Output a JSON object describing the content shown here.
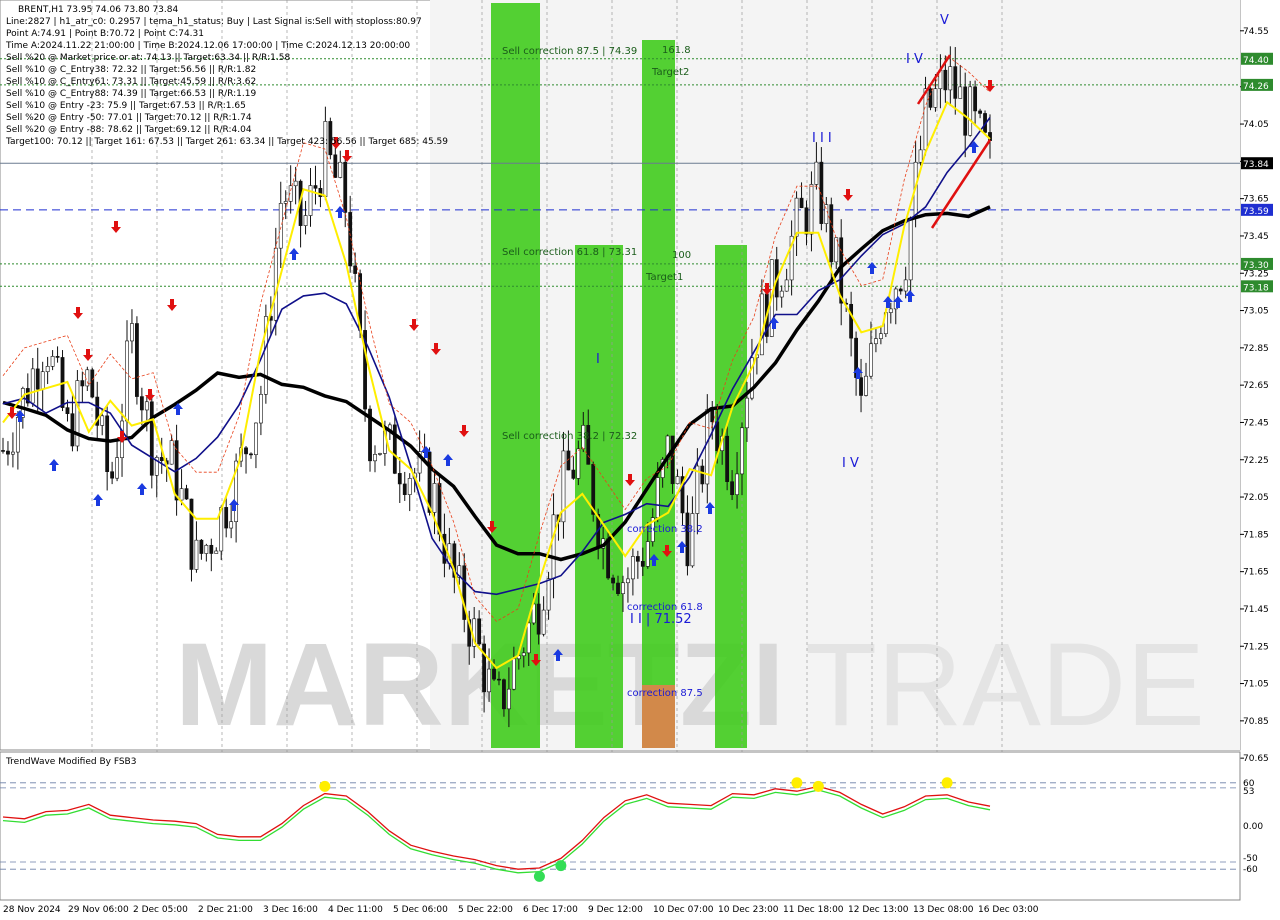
{
  "header": {
    "lines": [
      "BRENT,H1  73.95 74.06 73.80 73.84",
      "Line:2827 | h1_atr_c0: 0.2957 | tema_h1_status: Buy | Last Signal is:Sell with stoploss:80.97",
      "Point A:74.91 | Point B:70.72 | Point C:74.31",
      "Time A:2024.11.22 21:00:00 | Time B:2024.12.06 17:00:00 | Time C:2024.12.13 20:00:00",
      "Sell %20 @ Market price or at: 74.13 || Target:63.34 || R/R:1.58",
      "Sell %10 @ C_Entry38: 72.32 || Target:56.56 || R/R:1.82",
      "Sell %10 @ C_Entry61: 73.31 || Target:45.59 || R/R:3.62",
      "Sell %10 @ C_Entry88: 74.39 || Target:66.53 || R/R:1.19",
      "Sell %10 @ Entry -23: 75.9 || Target:67.53 || R/R:1.65",
      "Sell %20 @ Entry -50: 77.01 || Target:70.12 || R/R:1.74",
      "Sell %20 @ Entry -88: 78.62 || Target:69.12 || R/R:4.04",
      "Target100: 70.12 || Target 161: 67.53 || Target 261: 63.34 || Target 423: 56.56 || Target 685: 45.59"
    ]
  },
  "watermark": {
    "left": "MARKETZI",
    "right": "TRADE"
  },
  "main_axis": {
    "ticks": [
      "74.55",
      "74.25",
      "74.05",
      "73.85",
      "73.65",
      "73.45",
      "73.25",
      "73.05",
      "72.85",
      "72.65",
      "72.45",
      "72.25",
      "72.05",
      "71.85",
      "71.65",
      "71.45",
      "71.25",
      "71.05",
      "70.85",
      "70.65"
    ]
  },
  "price_tags": [
    {
      "label": "74.40",
      "color": "#2e8b2e"
    },
    {
      "label": "74.26",
      "color": "#2e8b2e"
    },
    {
      "label": "73.84",
      "color": "#000000"
    },
    {
      "label": "73.59",
      "color": "#1f2fd1"
    },
    {
      "label": "73.30",
      "color": "#2e8b2e"
    },
    {
      "label": "73.18",
      "color": "#2e8b2e"
    }
  ],
  "zone_labels": [
    {
      "text": "Sell correction 87.5 | 74.39",
      "color": "#1a5c1a"
    },
    {
      "text": "Sell correction 61.8 | 73.31",
      "color": "#1a5c1a"
    },
    {
      "text": "Sell correction 38.2 | 72.32",
      "color": "#1a5c1a"
    },
    {
      "text": "161.8",
      "color": "#1a5c1a"
    },
    {
      "text": "Target2",
      "color": "#1a5c1a"
    },
    {
      "text": "100",
      "color": "#1a5c1a"
    },
    {
      "text": "Target1",
      "color": "#1a5c1a"
    },
    {
      "text": "correction 38.2",
      "color": "#1a1ad6"
    },
    {
      "text": "correction 61.8",
      "color": "#1a1ad6"
    },
    {
      "text": "correction 87.5",
      "color": "#1a1ad6"
    }
  ],
  "wave_labels": [
    "V",
    "I V",
    "I I I",
    "I",
    "I V",
    "I I | 71.52"
  ],
  "x_axis": {
    "labels": [
      "28 Nov 2024",
      "29 Nov 06:00",
      "2 Dec 05:00",
      "2 Dec 21:00",
      "3 Dec 16:00",
      "4 Dec 11:00",
      "5 Dec 06:00",
      "5 Dec 22:00",
      "6 Dec 17:00",
      "9 Dec 12:00",
      "10 Dec 07:00",
      "10 Dec 23:00",
      "11 Dec 18:00",
      "12 Dec 13:00",
      "13 Dec 08:00",
      "16 Dec 03:00"
    ]
  },
  "indicator": {
    "title": "TrendWave Modified By FSB3",
    "ticks": [
      "60",
      "53",
      "0.00",
      "-50",
      "-60"
    ]
  },
  "colors": {
    "bull_zone": "#44cc22",
    "bear_zone_extra": "#d2894a",
    "trend_black": "#000000",
    "trend_blue": "#10108a",
    "trend_yellow": "#ffee00",
    "signal_red": "#e01010",
    "signal_blue": "#1a3ae0"
  },
  "chart_data": [
    {
      "type": "candlestick",
      "title": "BRENT,H1",
      "symbol": "BRENT",
      "timeframe": "H1",
      "ohlc_last": {
        "open": 73.95,
        "high": 74.06,
        "low": 73.8,
        "close": 73.84
      },
      "ylim": [
        70.6,
        74.6
      ],
      "x_labels": [
        "28 Nov 2024",
        "29 Nov 06:00",
        "2 Dec 05:00",
        "2 Dec 21:00",
        "3 Dec 16:00",
        "4 Dec 11:00",
        "5 Dec 06:00",
        "5 Dec 22:00",
        "6 Dec 17:00",
        "9 Dec 12:00",
        "10 Dec 07:00",
        "10 Dec 23:00",
        "11 Dec 18:00",
        "12 Dec 13:00",
        "13 Dec 08:00",
        "16 Dec 03:00"
      ],
      "close_path": [
        72.3,
        72.6,
        72.9,
        72.4,
        72.7,
        72.1,
        72.9,
        72.3,
        72.2,
        71.7,
        71.9,
        72.2,
        72.6,
        73.7,
        73.5,
        73.9,
        73.6,
        72.4,
        72.3,
        72.2,
        72.1,
        71.6,
        71.3,
        70.9,
        71.2,
        71.5,
        72.1,
        72.3,
        71.8,
        71.6,
        71.8,
        72.3,
        71.8,
        72.5,
        72.2,
        72.9,
        73.2,
        73.5,
        73.7,
        73.2,
        72.5,
        73.1,
        73.3,
        74.1,
        74.3,
        74.1,
        73.84
      ],
      "horizontal_levels": [
        {
          "value": 74.4,
          "style": "dotted",
          "color": "#2e8b2e"
        },
        {
          "value": 74.26,
          "style": "dotted",
          "color": "#2e8b2e"
        },
        {
          "value": 73.84,
          "style": "solid",
          "color": "#6b7b90"
        },
        {
          "value": 73.59,
          "style": "dashed",
          "color": "#1f2fd1"
        },
        {
          "value": 73.3,
          "style": "dotted",
          "color": "#2e8b2e"
        },
        {
          "value": 73.18,
          "style": "dotted",
          "color": "#2e8b2e"
        }
      ],
      "grid": true
    },
    {
      "type": "line",
      "title": "TrendWave Modified By FSB3",
      "ylim": [
        -100,
        100
      ],
      "levels": [
        60,
        53,
        0,
        -50,
        -60
      ],
      "series": [
        {
          "color": "#e01010",
          "values": [
            10,
            15,
            5,
            40,
            20,
            30,
            -5,
            10,
            20,
            -10,
            0,
            -25,
            -20,
            0,
            30,
            55,
            50,
            20,
            -10,
            -30,
            -40,
            -35,
            -50,
            -55,
            -60,
            -65,
            -50,
            -20,
            10,
            45,
            50,
            35,
            10,
            45,
            30,
            60,
            40,
            55,
            50,
            60,
            30,
            0,
            20,
            60,
            45,
            25,
            30
          ]
        },
        {
          "color": "#33dd33",
          "values": [
            5,
            10,
            0,
            35,
            15,
            25,
            -10,
            5,
            15,
            -15,
            -5,
            -30,
            -25,
            -5,
            25,
            50,
            45,
            15,
            -15,
            -35,
            -45,
            -40,
            -55,
            -60,
            -65,
            -70,
            -55,
            -25,
            5,
            40,
            45,
            30,
            5,
            40,
            25,
            55,
            35,
            50,
            45,
            55,
            25,
            -5,
            15,
            55,
            40,
            20,
            25
          ]
        }
      ],
      "markers": [
        {
          "color": "#ffee00",
          "index": 15,
          "value": 55
        },
        {
          "color": "#33dd55",
          "index": 25,
          "value": -70
        },
        {
          "color": "#33dd55",
          "index": 26,
          "value": -55
        },
        {
          "color": "#ffee00",
          "index": 37,
          "value": 60
        },
        {
          "color": "#ffee00",
          "index": 38,
          "value": 55
        },
        {
          "color": "#ffee00",
          "index": 44,
          "value": 60
        }
      ]
    }
  ]
}
